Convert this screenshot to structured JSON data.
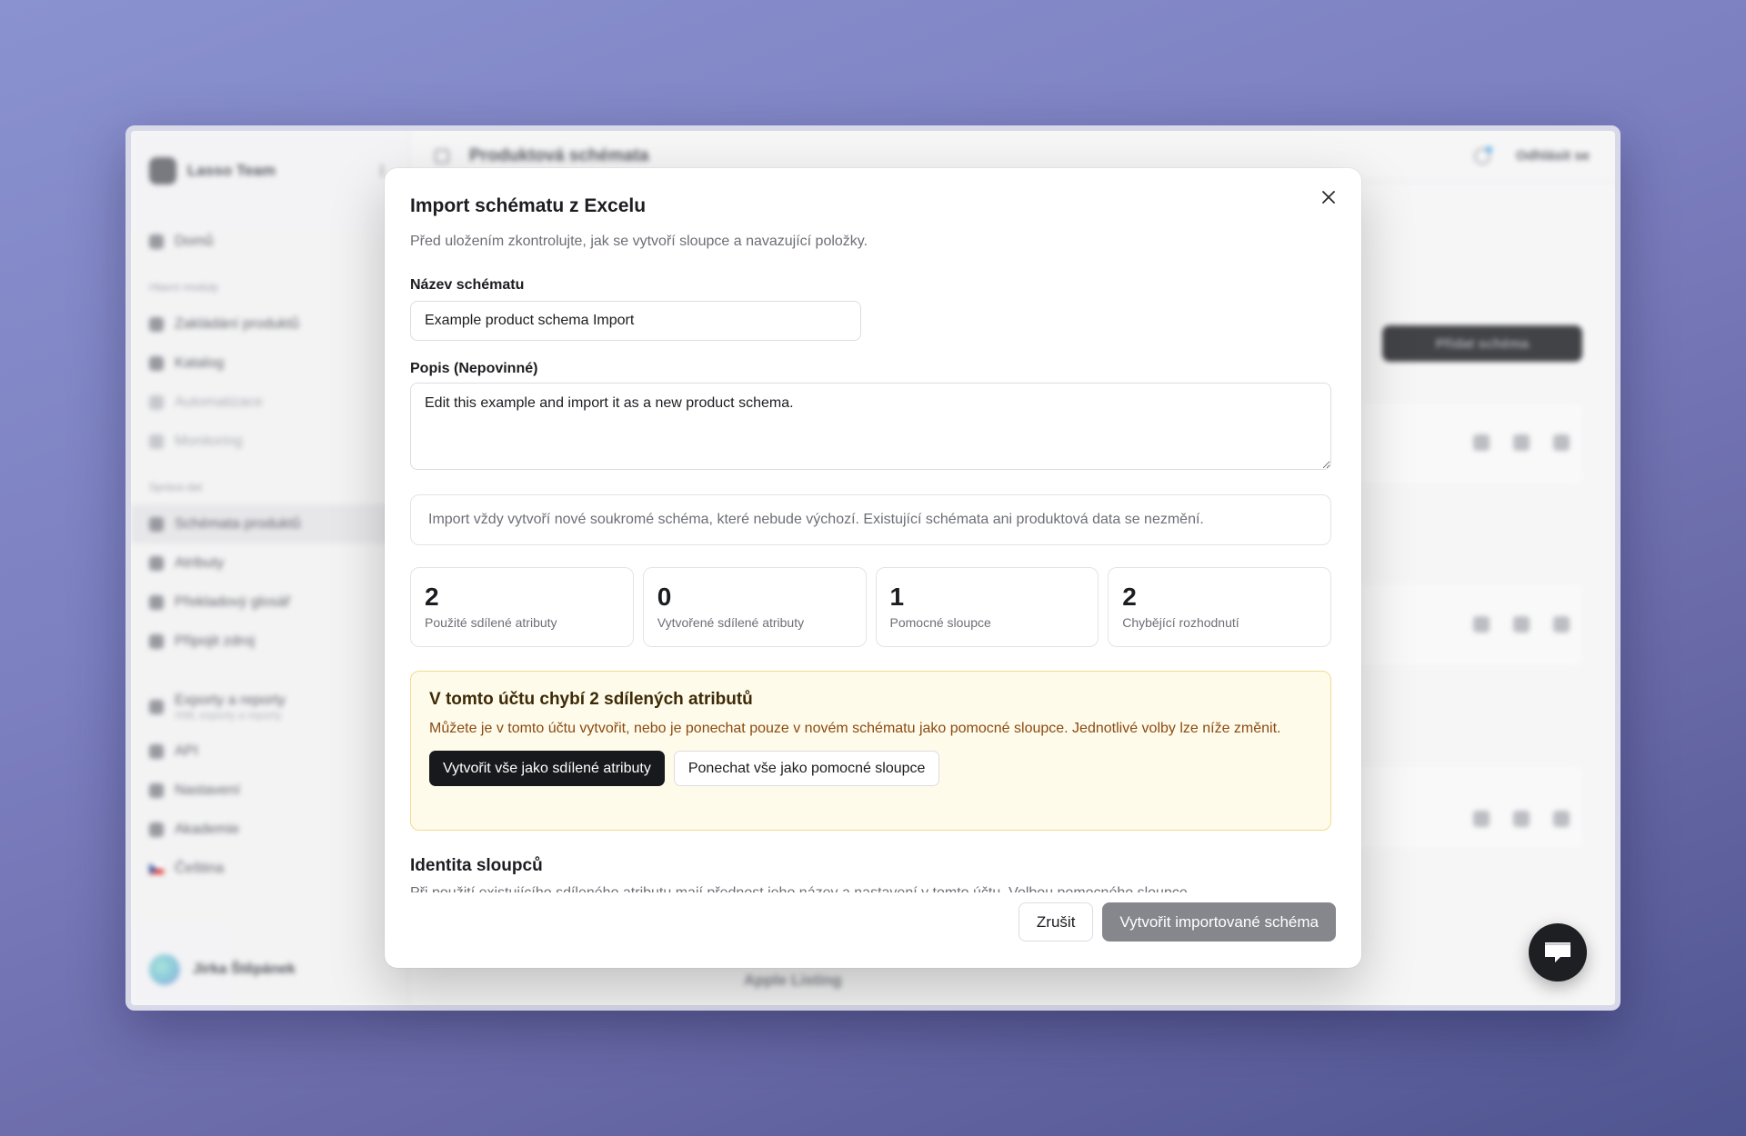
{
  "app": {
    "team_name": "Lasso Team",
    "page_title": "Produktová schémata",
    "logout_label": "Odhlásit se",
    "add_button_label": "Přidat schéma",
    "bottom_row_label": "Apple Listing",
    "sidebar": {
      "home": "Domů",
      "section_main": "Hlavní moduly",
      "items_main": [
        {
          "label": "Zakládání produktů",
          "icon": "box-icon"
        },
        {
          "label": "Katalog",
          "icon": "grid-icon"
        },
        {
          "label": "Automatizace",
          "icon": "bolt-icon",
          "faint": true
        },
        {
          "label": "Monitoring",
          "icon": "pulse-icon",
          "faint": true
        }
      ],
      "section_admin": "Správa dat",
      "items_admin": [
        {
          "label": "Schémata produktů",
          "icon": "schema-icon",
          "active": true
        },
        {
          "label": "Atributy",
          "icon": "tag-icon"
        },
        {
          "label": "Překladový glosář",
          "icon": "globe-icon"
        },
        {
          "label": "Připojit zdroj",
          "icon": "plug-icon"
        }
      ],
      "exports": {
        "label": "Exporty a reporty",
        "sub": "XML exporty a reporty"
      },
      "items_bottom": [
        {
          "label": "API",
          "icon": "link-icon"
        },
        {
          "label": "Nastavení",
          "icon": "gear-icon"
        },
        {
          "label": "Akademie",
          "icon": "academy-icon"
        }
      ],
      "language": "Čeština",
      "user_name": "Jirka Štěpánek"
    }
  },
  "modal": {
    "title": "Import schématu z Excelu",
    "description": "Před uložením zkontrolujte, jak se vytvoří sloupce a navazující položky.",
    "name_label": "Název schématu",
    "name_value": "Example product schema Import",
    "desc_label": "Popis (Nepovinné)",
    "desc_value": "Edit this example and import it as a new product schema.",
    "note": "Import vždy vytvoří nové soukromé schéma, které nebude výchozí. Existující schémata ani produktová data se nezmění.",
    "stats": [
      {
        "value": "2",
        "label": "Použité sdílené atributy"
      },
      {
        "value": "0",
        "label": "Vytvořené sdílené atributy"
      },
      {
        "value": "1",
        "label": "Pomocné sloupce"
      },
      {
        "value": "2",
        "label": "Chybějící rozhodnutí"
      }
    ],
    "warning": {
      "title": "V tomto účtu chybí 2 sdílených atributů",
      "text": "Můžete je v tomto účtu vytvořit, nebo je ponechat pouze v novém schématu jako pomocné sloupce. Jednotlivé volby lze níže změnit.",
      "create_all_label": "Vytvořit vše jako sdílené atributy",
      "keep_all_label": "Ponechat vše jako pomocné sloupce"
    },
    "identity_title": "Identita sloupců",
    "identity_text": "Při použití existujícího sdíleného atributu mají přednost jeho název a nastavení v tomto účtu. Volbou pomocného sloupce",
    "cancel_label": "Zrušit",
    "submit_label": "Vytvořit importované schéma"
  },
  "colors": {
    "warning_bg": "#fffbea",
    "warning_border": "#f1dc8f",
    "primary_disabled": "#86878c",
    "dark_button": "#18191c"
  }
}
